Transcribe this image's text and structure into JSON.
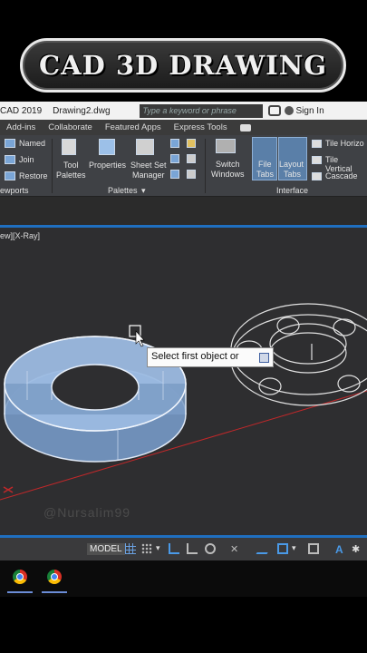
{
  "banner": {
    "title": "CAD 3D DRAWING"
  },
  "titlebar": {
    "app": "CAD 2019",
    "file": "Drawing2.dwg",
    "search_placeholder": "Type a keyword or phrase",
    "signin": "Sign In"
  },
  "menubar": {
    "items": [
      "Add-ins",
      "Collaborate",
      "Featured Apps",
      "Express Tools"
    ]
  },
  "ribbon": {
    "viewports": {
      "named": "Named",
      "join": "Join",
      "restore": "Restore",
      "panel": "ewports"
    },
    "palettes": {
      "tool_palettes_1": "Tool",
      "tool_palettes_2": "Palettes",
      "properties": "Properties",
      "sheet_set_1": "Sheet Set",
      "sheet_set_2": "Manager",
      "panel": "Palettes"
    },
    "interface": {
      "switch_1": "Switch",
      "switch_2": "Windows",
      "file_tabs_1": "File",
      "file_tabs_2": "Tabs",
      "layout_tabs_1": "Layout",
      "layout_tabs_2": "Tabs",
      "tile_h": "Tile Horizo",
      "tile_v": "Tile Vertical",
      "cascade": "Cascade",
      "panel": "Interface"
    }
  },
  "viewport": {
    "label": "ew][X-Ray]",
    "tooltip": "Select first object or",
    "watermark": "@Nursalim99"
  },
  "statusbar": {
    "model": "MODEL"
  },
  "colors": {
    "accent": "#1f6fc0",
    "torus_fill": "#8fb3e0",
    "axis_red": "#c0282a"
  }
}
